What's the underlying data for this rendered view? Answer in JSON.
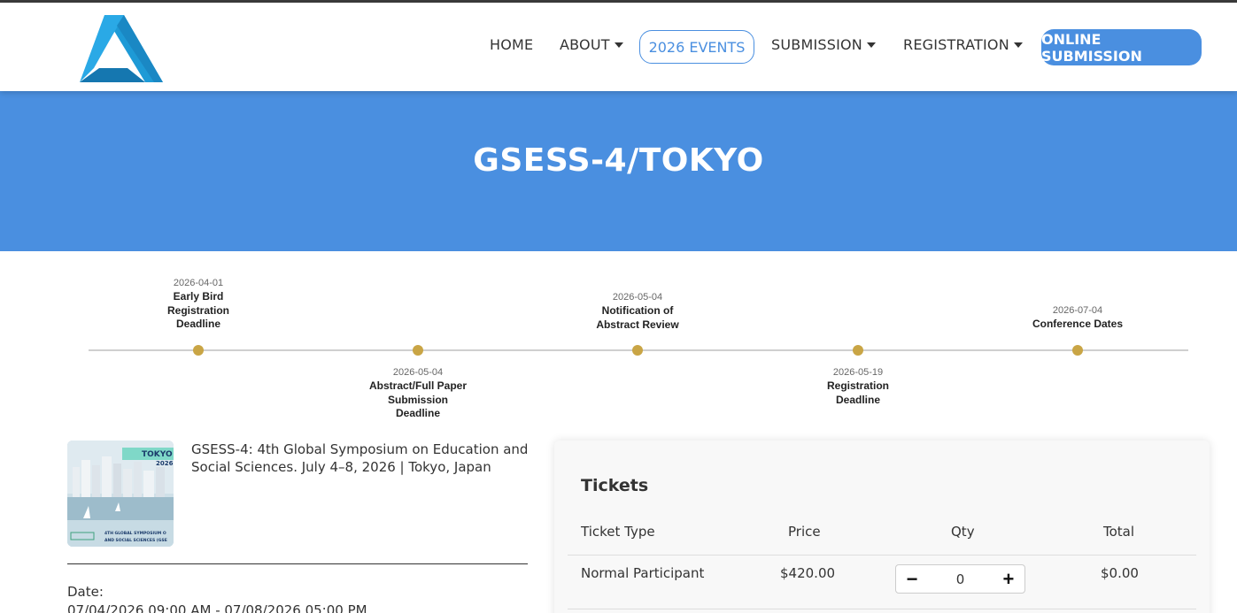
{
  "nav": {
    "home": "HOME",
    "about": "ABOUT",
    "events": "2026 EVENTS",
    "submission": "SUBMISSION",
    "registration": "REGISTRATION",
    "online_submission": "ONLINE SUBMISSION"
  },
  "colors": {
    "accent": "#4a8fe0",
    "timeline_dot": "#c9a545",
    "logo_blue": "#1e9ad6"
  },
  "banner": {
    "title": "GSESS-4/TOKYO"
  },
  "timeline": [
    {
      "date": "2026-04-01",
      "label_lines": [
        "Early Bird",
        "Registration",
        "Deadline"
      ]
    },
    {
      "date": "2026-05-04",
      "label_lines": [
        "Abstract/Full Paper",
        "Submission",
        "Deadline"
      ]
    },
    {
      "date": "2026-05-04",
      "label_lines": [
        "Notification of",
        "Abstract Review"
      ]
    },
    {
      "date": "2026-05-19",
      "label_lines": [
        "Registration",
        "Deadline"
      ]
    },
    {
      "date": "2026-07-04",
      "label_lines": [
        "Conference Dates"
      ]
    }
  ],
  "event": {
    "thumb_title": "TOKYO",
    "thumb_year": "2026.",
    "thumb_caption_1": "4TH GLOBAL SYMPOSIUM O",
    "thumb_caption_2": "AND SOCIAL SCIENCES (GSE",
    "description": "GSESS-4: 4th Global Symposium on Education and Social Sciences. July 4–8, 2026 | Tokyo, Japan",
    "date_label": "Date:",
    "date_value": "07/04/2026 09:00 AM - 07/08/2026 05:00 PM"
  },
  "tickets": {
    "title": "Tickets",
    "headers": {
      "type": "Ticket Type",
      "price": "Price",
      "qty": "Qty",
      "total": "Total"
    },
    "rows": [
      {
        "type": "Normal Participant",
        "price": "$420.00",
        "qty": "0",
        "total": "$0.00"
      }
    ],
    "minus": "−",
    "plus": "+"
  }
}
